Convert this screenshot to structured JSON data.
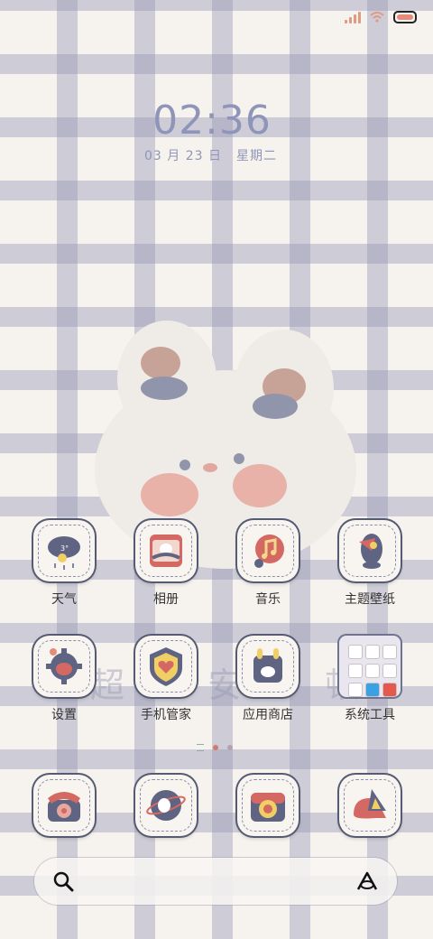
{
  "status": {
    "signal": "signal-icon",
    "wifi": "wifi-icon",
    "battery": "battery-icon"
  },
  "lockscreen": {
    "time": "02:36",
    "date": "03 月 23 日",
    "weekday": "星期二"
  },
  "apps": [
    {
      "label": "天气",
      "icon": "weather-icon"
    },
    {
      "label": "相册",
      "icon": "gallery-icon"
    },
    {
      "label": "音乐",
      "icon": "music-icon"
    },
    {
      "label": "主题壁纸",
      "icon": "theme-icon"
    },
    {
      "label": "设置",
      "icon": "settings-icon"
    },
    {
      "label": "手机管家",
      "icon": "security-icon"
    },
    {
      "label": "应用商店",
      "icon": "appstore-icon"
    },
    {
      "label": "系统工具",
      "icon": "folder-icon"
    }
  ],
  "dock": [
    {
      "icon": "phone-icon"
    },
    {
      "icon": "browser-icon"
    },
    {
      "icon": "camera-icon"
    },
    {
      "icon": "messages-icon"
    }
  ],
  "search_bar": {
    "search_icon": "search-icon",
    "assistant_icon": "assistant-icon"
  },
  "page_indicator": {
    "pages": 2,
    "active": 1
  },
  "wallpaper_text": "超 安 顿",
  "colors": {
    "accent": "#8f95b8",
    "grid": "#9698b4",
    "pink": "#e58b79",
    "navy": "#565b74"
  }
}
